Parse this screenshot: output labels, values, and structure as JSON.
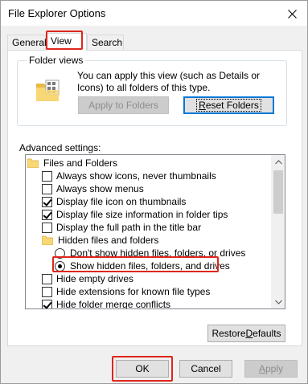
{
  "window": {
    "title": "File Explorer Options",
    "close_icon": "close-icon"
  },
  "tabs": [
    {
      "label": "General",
      "active": false
    },
    {
      "label": "View",
      "active": true
    },
    {
      "label": "Search",
      "active": false
    }
  ],
  "folder_views": {
    "legend": "Folder views",
    "icon": "folder-views-icon",
    "description": "You can apply this view (such as Details or Icons) to all folders of this type.",
    "apply_button": "Apply to Folders",
    "reset_button_prefix": "",
    "reset_button_mnemonic": "R",
    "reset_button_rest": "eset Folders"
  },
  "advanced": {
    "label": "Advanced settings:",
    "items": [
      {
        "type": "folder",
        "label": "Files and Folders"
      },
      {
        "type": "checkbox",
        "checked": false,
        "label": "Always show icons, never thumbnails"
      },
      {
        "type": "checkbox",
        "checked": false,
        "label": "Always show menus"
      },
      {
        "type": "checkbox",
        "checked": true,
        "label": "Display file icon on thumbnails"
      },
      {
        "type": "checkbox",
        "checked": true,
        "label": "Display file size information in folder tips"
      },
      {
        "type": "checkbox",
        "checked": false,
        "label": "Display the full path in the title bar"
      },
      {
        "type": "folder",
        "label": "Hidden files and folders"
      },
      {
        "type": "radio",
        "checked": false,
        "label": "Don't show hidden files, folders, or drives"
      },
      {
        "type": "radio",
        "checked": true,
        "label": "Show hidden files, folders, and drives"
      },
      {
        "type": "checkbox",
        "checked": false,
        "label": "Hide empty drives"
      },
      {
        "type": "checkbox",
        "checked": false,
        "label": "Hide extensions for known file types"
      },
      {
        "type": "checkbox",
        "checked": true,
        "label": "Hide folder merge conflicts"
      }
    ]
  },
  "restore_button_prefix": "Restore ",
  "restore_button_mnemonic": "D",
  "restore_button_rest": "efaults",
  "dialog_buttons": {
    "ok": "OK",
    "cancel": "Cancel",
    "apply_mnemonic": "A",
    "apply_rest": "pply"
  },
  "colors": {
    "highlight_red": "#e0251b",
    "focus_blue": "#0078d7",
    "folder_yellow": "#f8d775"
  }
}
